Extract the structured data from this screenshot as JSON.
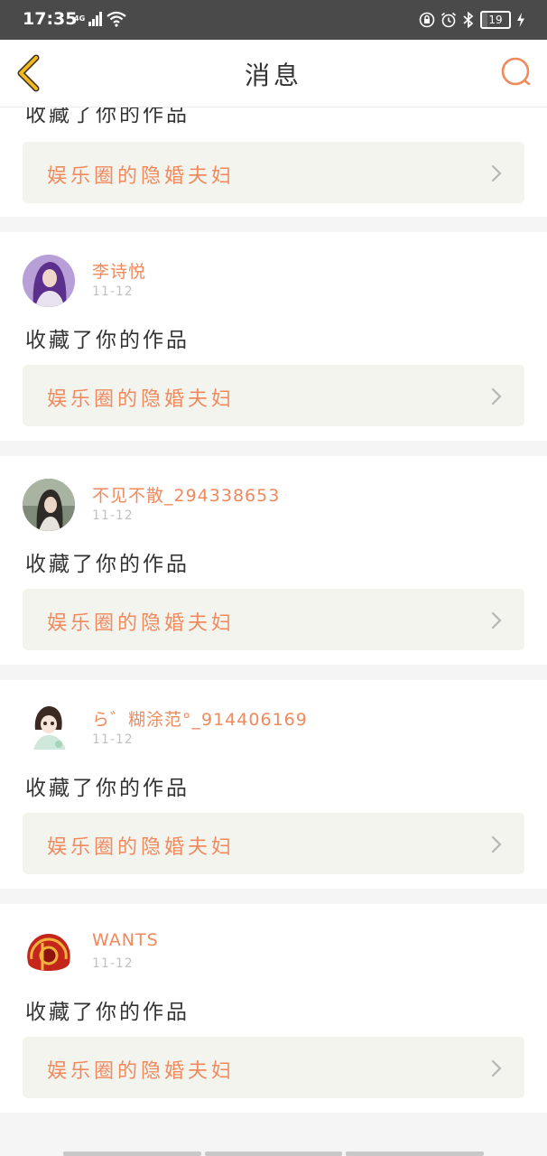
{
  "status_bar": {
    "time": "17:35",
    "network": "4G",
    "battery": "19",
    "battery_level": 0.19
  },
  "header": {
    "title": "消息"
  },
  "top_item": {
    "action": "收藏了你的作品",
    "work_title": "娱乐圈的隐婚夫妇"
  },
  "messages": [
    {
      "username": "李诗悦",
      "date": "11-12",
      "action": "收藏了你的作品",
      "work_title": "娱乐圈的隐婚夫妇"
    },
    {
      "username": "不见不散_294338653",
      "date": "11-12",
      "action": "收藏了你的作品",
      "work_title": "娱乐圈的隐婚夫妇"
    },
    {
      "username": "ら゛糊涂范°_914406169",
      "date": "11-12",
      "action": "收藏了你的作品",
      "work_title": "娱乐圈的隐婚夫妇"
    },
    {
      "username": "WANTS",
      "date": "11-12",
      "action": "收藏了你的作品",
      "work_title": "娱乐圈的隐婚夫妇"
    }
  ],
  "colors": {
    "accent": "#f08a5d",
    "back_icon": "#f2b81c",
    "status_bar": "#4a4a4a",
    "work_box_bg": "#f4f4ef"
  }
}
